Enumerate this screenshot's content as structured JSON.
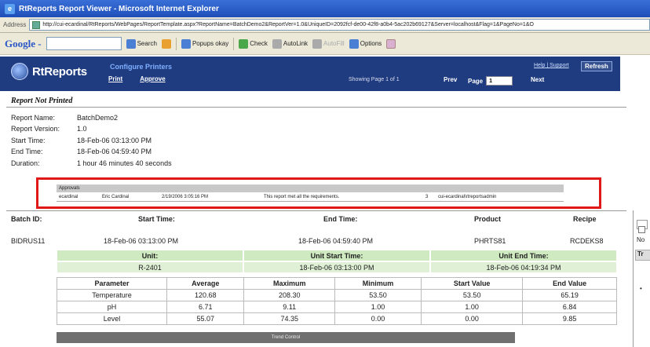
{
  "window": {
    "title": "RtReports Report Viewer - Microsoft Internet Explorer"
  },
  "address": {
    "label": "Address",
    "url": "http://cui-ecardinal/RtReports/WebPages/ReportTemplate.aspx?ReportName=BatchDemo2&ReportVer=1.0&UniqueID=2092fcf-de00-42f8-a0b4-5ac202b69127&Server=localhost&Flag=1&PageNo=1&O"
  },
  "google_toolbar": {
    "logo": "Google -",
    "search": "Search",
    "popups": "Popups okay",
    "check": "Check",
    "autolink": "AutoLink",
    "autofill": "AutoFill",
    "options": "Options"
  },
  "rt_header": {
    "logo": "RtReports",
    "title": "Configure Printers",
    "nav": [
      "Print",
      "Approve"
    ],
    "showing": "Showing Page 1 of 1",
    "prev": "Prev",
    "page_label": "Page",
    "page_value": "1",
    "next": "Next",
    "help": "Help",
    "support": "Support",
    "refresh": "Refresh"
  },
  "report_status": "Report Not Printed",
  "meta": [
    {
      "label": "Report Name:",
      "value": "BatchDemo2"
    },
    {
      "label": "Report Version:",
      "value": "1.0"
    },
    {
      "label": "Start Time:",
      "value": "18-Feb-06 03:13:00 PM"
    },
    {
      "label": "End Time:",
      "value": "18-Feb-06 04:59:40 PM"
    },
    {
      "label": "Duration:",
      "value": "1 hour 46 minutes 40 seconds"
    }
  ],
  "approvals": {
    "header": "Approvals",
    "row": {
      "user": "ecardinal",
      "name": "Eric Cardinal",
      "date": "2/19/2006 3:05:16 PM",
      "comment": "This report met all the requirements.",
      "count": "3",
      "account": "cui-ecardinal\\rtreportsadmin"
    }
  },
  "batch": {
    "headers": {
      "batch_id": "Batch ID:",
      "start": "Start Time:",
      "end": "End Time:",
      "product": "Product",
      "recipe": "Recipe"
    },
    "values": {
      "batch_id": "BIDRUS11",
      "start": "18-Feb-06 03:13:00 PM",
      "end": "18-Feb-06 04:59:40 PM",
      "product": "PHRTS81",
      "recipe": "RCDEKS8"
    }
  },
  "unit": {
    "headers": [
      "Unit:",
      "Unit Start Time:",
      "Unit End Time:"
    ],
    "values": [
      "R-2401",
      "18-Feb-06 03:13:00 PM",
      "18-Feb-06 04:19:34 PM"
    ]
  },
  "params": {
    "columns": [
      "Parameter",
      "Average",
      "Maximum",
      "Minimum",
      "Start Value",
      "End Value"
    ],
    "rows": [
      [
        "Temperature",
        "120.68",
        "208.30",
        "53.50",
        "53.50",
        "65.19"
      ],
      [
        "pH",
        "6.71",
        "9.11",
        "1.00",
        "1.00",
        "6.84"
      ],
      [
        "Level",
        "55.07",
        "74.35",
        "0.00",
        "0.00",
        "9.85"
      ]
    ]
  },
  "trend_control": "Trend Control",
  "right_strip": {
    "no": "No",
    "bar": "Tr"
  }
}
